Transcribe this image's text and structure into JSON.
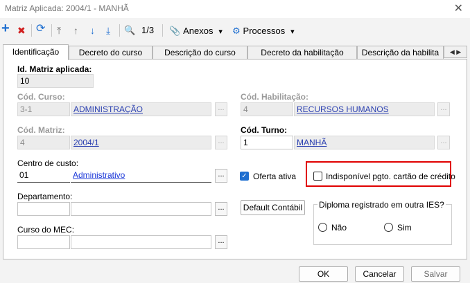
{
  "window": {
    "title": "Matriz Aplicada: 2004/1 - MANHÃ",
    "close_glyph": "✕"
  },
  "toolbar": {
    "add_glyph": "+",
    "delete_glyph": "✖",
    "refresh_glyph": "⟳",
    "first_glyph": "⤒",
    "up_glyph": "↑",
    "down_glyph": "↓",
    "last_glyph": "⤓",
    "search_glyph": "🔍",
    "record_counter": "1/3",
    "attachments_label": "Anexos",
    "processes_label": "Processos",
    "dropdown_glyph": "▾"
  },
  "tabs": [
    {
      "label": "Identificação",
      "active": true
    },
    {
      "label": "Decreto do curso",
      "active": false
    },
    {
      "label": "Descrição do curso",
      "active": false
    },
    {
      "label": "Decreto da habilitação",
      "active": false
    },
    {
      "label": "Descrição da habilita",
      "active": false
    }
  ],
  "tab_nav": {
    "left": "◀",
    "right": "▶"
  },
  "form": {
    "id_matriz": {
      "label": "Id. Matriz aplicada:",
      "value": "10"
    },
    "cod_curso": {
      "label": "Cód. Curso:",
      "code": "3-1",
      "name": "ADMINISTRAÇÃO"
    },
    "cod_habilitacao": {
      "label": "Cód. Habilitação:",
      "code": "4",
      "name": "RECURSOS HUMANOS"
    },
    "cod_matriz": {
      "label": "Cód. Matriz:",
      "code": "4",
      "name": "2004/1"
    },
    "cod_turno": {
      "label": "Cód. Turno:",
      "code": "1",
      "name": "MANHÃ"
    },
    "centro_custo": {
      "label": "Centro de custo:",
      "code": "01",
      "name": "Administrativo"
    },
    "departamento": {
      "label": "Departamento:",
      "code": "",
      "name": ""
    },
    "curso_mec": {
      "label": "Curso do MEC:",
      "code": "",
      "name": ""
    },
    "ellipsis": "...",
    "oferta_ativa": {
      "label": "Oferta ativa",
      "checked": true
    },
    "indisponivel_cartao": {
      "label": "Indisponível pgto. cartão de crédito",
      "checked": false
    },
    "default_contabil": "Default Contábil",
    "diploma": {
      "title": "Diploma registrado em outra IES?",
      "option_no": "Não",
      "option_yes": "Sim"
    }
  },
  "footer": {
    "ok": "OK",
    "cancel": "Cancelar",
    "save": "Salvar"
  },
  "colors": {
    "highlight": "#e00000",
    "link": "#1a37d8",
    "check": "#1f6fd0",
    "add": "#1f6fd0",
    "delete": "#d12020"
  }
}
